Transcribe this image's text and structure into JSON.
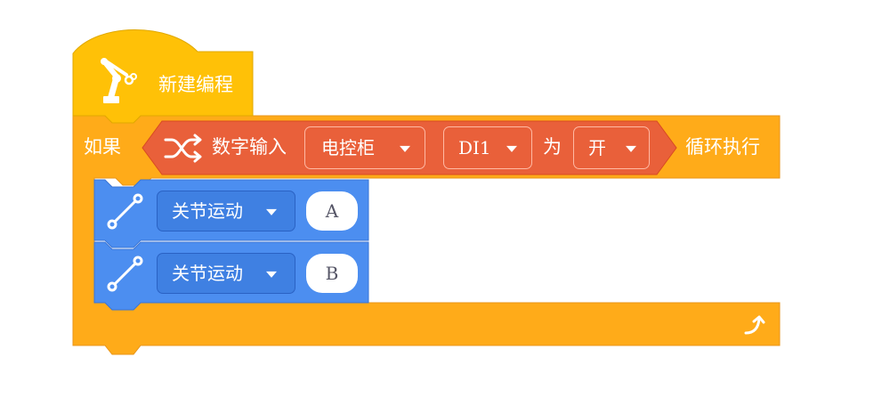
{
  "hat_block": {
    "label": "新建编程",
    "icon": "robot-arm-icon",
    "color": "#ffc107"
  },
  "if_block": {
    "if_label": "如果",
    "loop_label": "循环执行",
    "color": "#ffab19",
    "loop_icon": "loop-arrow-icon"
  },
  "condition": {
    "icon": "shuffle-icon",
    "label": "数字输入",
    "source": "电控柜",
    "port": "DI1",
    "is_label": "为",
    "state": "开",
    "color": "#e9603a"
  },
  "motions": [
    {
      "icon": "joint-move-icon",
      "mode": "关节运动",
      "point": "A"
    },
    {
      "icon": "joint-move-icon",
      "mode": "关节运动",
      "point": "B"
    }
  ],
  "motion_color": "#4c8ef0"
}
